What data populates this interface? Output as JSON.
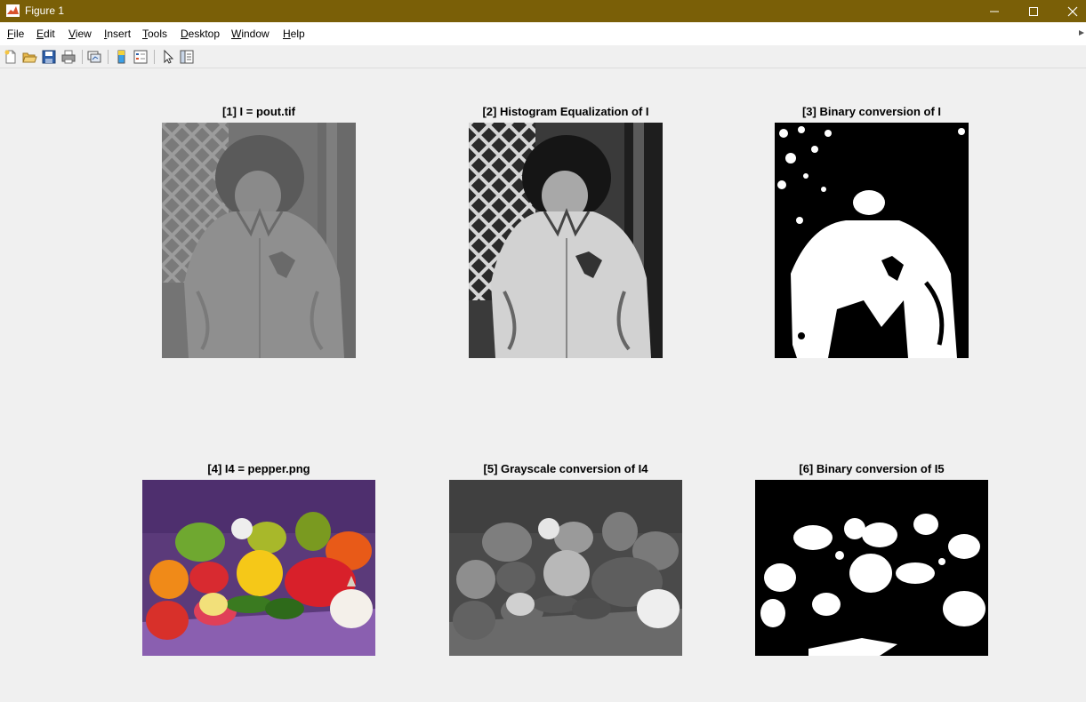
{
  "window": {
    "title": "Figure 1"
  },
  "menu": {
    "items": [
      {
        "acc": "F",
        "rest": "ile"
      },
      {
        "acc": "E",
        "rest": "dit"
      },
      {
        "acc": "V",
        "rest": "iew"
      },
      {
        "acc": "I",
        "rest": "nsert"
      },
      {
        "acc": "T",
        "rest": "ools"
      },
      {
        "acc": "D",
        "rest": "esktop"
      },
      {
        "acc": "W",
        "rest": "indow"
      },
      {
        "acc": "H",
        "rest": "elp"
      }
    ]
  },
  "toolbar": {
    "icons": [
      "new-figure-icon",
      "open-file-icon",
      "save-icon",
      "print-icon",
      "link-plot-icon",
      "colorbar-icon",
      "legend-icon",
      "pointer-icon",
      "property-inspector-icon"
    ]
  },
  "panels": [
    {
      "title": "[1] I = pout.tif"
    },
    {
      "title": "[2] Histogram Equalization of I"
    },
    {
      "title": "[3] Binary conversion of I"
    },
    {
      "title": "[4] I4 = pepper.png"
    },
    {
      "title": "[5] Grayscale conversion of I4"
    },
    {
      "title": "[6] Binary conversion of I5"
    }
  ],
  "colors": {
    "titlebar": "#7a5f07",
    "figure_background": "#f0f0f0"
  }
}
